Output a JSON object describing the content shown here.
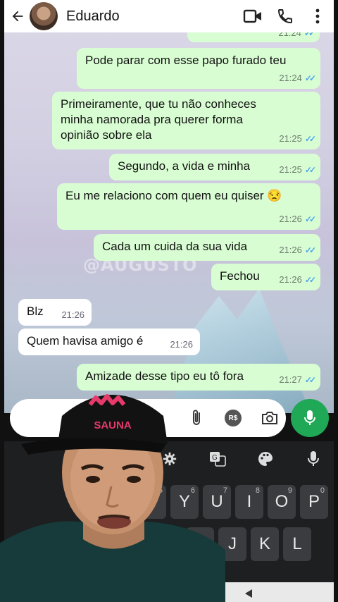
{
  "header": {
    "contact_name": "Eduardo",
    "icons": [
      "back-arrow-icon",
      "avatar",
      "video-call-icon",
      "phone-icon",
      "more-icon"
    ]
  },
  "watermark": "@AUGUSTO",
  "messages": [
    {
      "dir": "out",
      "text": "",
      "time": "21:24"
    },
    {
      "dir": "out",
      "text": "Pode parar com esse papo furado teu",
      "time": "21:24"
    },
    {
      "dir": "out",
      "text": "Primeiramente, que tu não conheces minha namorada pra querer forma opinião sobre ela",
      "time": "21:25"
    },
    {
      "dir": "out",
      "text": "Segundo, a vida e minha",
      "time": "21:25"
    },
    {
      "dir": "out",
      "text": "Eu me relaciono com quem eu quiser 😒",
      "time": "21:26"
    },
    {
      "dir": "out",
      "text": "Cada um cuida da sua vida",
      "time": "21:26"
    },
    {
      "dir": "out",
      "text": "Fechou",
      "time": "21:26"
    },
    {
      "dir": "in",
      "text": "Blz",
      "time": "21:26"
    },
    {
      "dir": "in",
      "text": "Quem havisa amigo é",
      "time": "21:26"
    },
    {
      "dir": "out",
      "text": "Amizade desse tipo eu tô fora",
      "time": "21:27"
    }
  ],
  "input": {
    "icons": [
      "attach-icon",
      "payment-icon",
      "camera-icon",
      "mic-icon"
    ],
    "payment_label": "R$"
  },
  "keyboard": {
    "tools": [
      "settings-icon",
      "translate-icon",
      "palette-icon",
      "mic-icon"
    ],
    "row1": [
      {
        "k": "T",
        "n": "5"
      },
      {
        "k": "Y",
        "n": "6"
      },
      {
        "k": "U",
        "n": "7"
      },
      {
        "k": "I",
        "n": "8"
      },
      {
        "k": "O",
        "n": "9"
      },
      {
        "k": "P",
        "n": "0"
      }
    ],
    "row2": [
      "H",
      "J",
      "K",
      "L"
    ]
  },
  "overlay": {
    "cap_text": "SAUNA"
  },
  "colors": {
    "outgoing": "#d9fdd3",
    "incoming": "#ffffff",
    "tick_blue": "#4fa6e8",
    "mic_green": "#1fa855"
  }
}
